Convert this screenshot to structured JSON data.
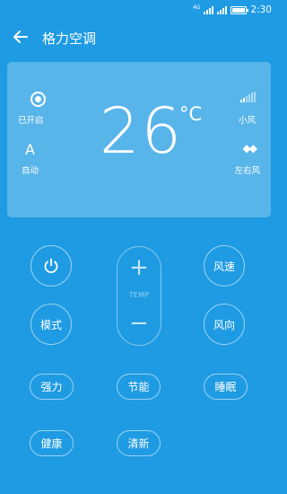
{
  "status_bar": {
    "network": "4G",
    "time": "2:30"
  },
  "header": {
    "title": "格力空调"
  },
  "ac_state": {
    "power_label": "已开启",
    "mode_letter": "A",
    "mode_label": "自动",
    "temperature": "26",
    "temperature_unit": "°C",
    "fan_label": "小风",
    "swing_symbol": "◆◆",
    "swing_label": "左右风"
  },
  "controls": {
    "temp_plus": "+",
    "temp_label": "TEMP",
    "temp_minus": "−",
    "fan_speed": "风速",
    "mode": "模式",
    "fan_direction": "风向",
    "strong": "强力",
    "energy_saving": "节能",
    "sleep": "睡眠",
    "health": "健康",
    "clean": "清新"
  },
  "colors": {
    "background": "#1e9be3",
    "card": "rgba(255,255,255,0.26)",
    "text": "#ffffff"
  },
  "icons": {
    "back": "arrow-left-icon",
    "power": "power-icon",
    "fan_level": "signal-bars-icon",
    "swing": "left-right-arrows-icon"
  }
}
